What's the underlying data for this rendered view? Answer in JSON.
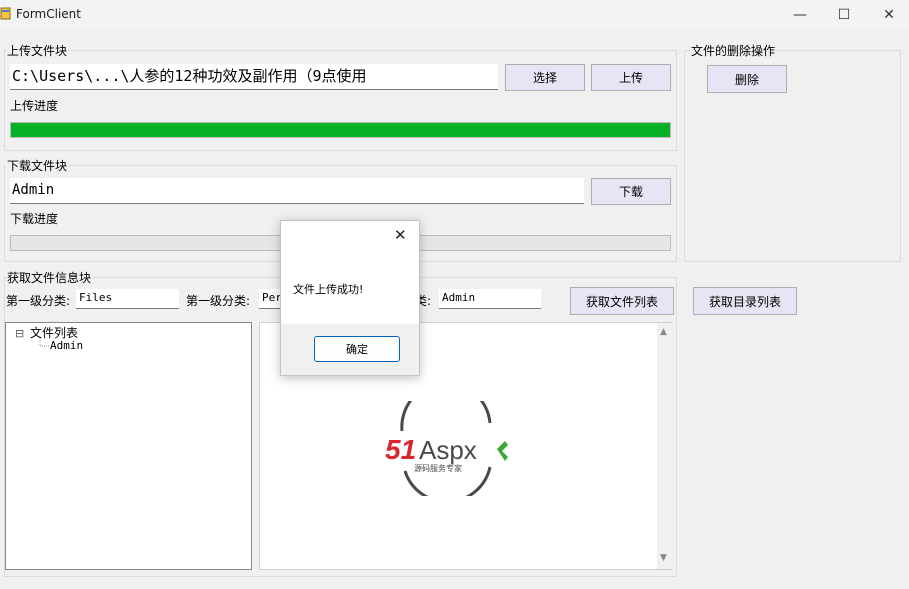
{
  "window": {
    "title": "FormClient",
    "minimize_glyph": "—",
    "maximize_glyph": "☐",
    "close_glyph": "✕"
  },
  "upload": {
    "group_label": "上传文件块",
    "file_path": "C:\\Users\\...\\人参的12种功效及副作用（9点使用",
    "select_label": "选择",
    "upload_label": "上传",
    "progress_label": "上传进度",
    "progress": 1.0
  },
  "delete_group": {
    "group_label": "文件的删除操作",
    "delete_label": "删除"
  },
  "download": {
    "group_label": "下载文件块",
    "file_value": "Admin",
    "download_label": "下载",
    "progress_label": "下载进度",
    "progress": 0.0
  },
  "info": {
    "group_label": "获取文件信息块",
    "level1_label": "第一级分类:",
    "level1_value": "Files",
    "level2_label": "第一级分类:",
    "level2_value": "Per",
    "level3_label": "类:",
    "level3_value": "Admin",
    "get_files_label": "获取文件列表",
    "get_dirs_label": "获取目录列表"
  },
  "tree": {
    "root_label": "文件列表",
    "expander": "⊟",
    "children": [
      "Admin"
    ]
  },
  "logo": {
    "text_51": "51",
    "text_aspx": "Aspx",
    "subtitle": "源码服务专家",
    "color_red": "#d9262c",
    "color_dark": "#4a4a4a",
    "color_green": "#39a935"
  },
  "dialog": {
    "message": "文件上传成功!",
    "ok_label": "确定",
    "close_glyph": "✕"
  },
  "colors": {
    "progress_fill": "#06b025",
    "button_bg": "#e5e5f5",
    "ok_border": "#0067c0"
  }
}
